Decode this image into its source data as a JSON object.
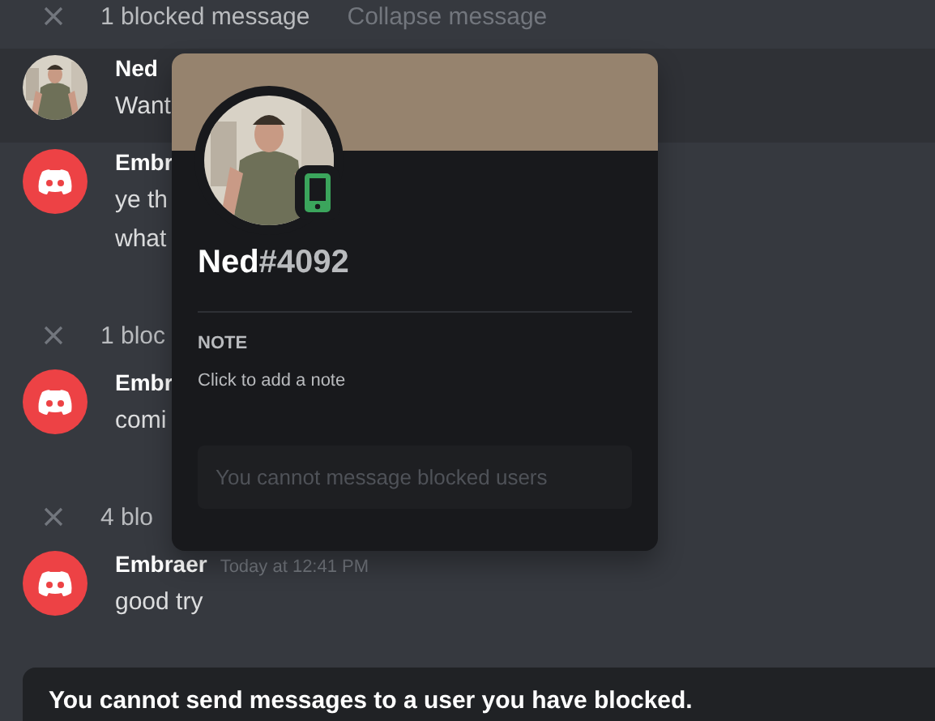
{
  "chat": [
    {
      "kind": "blocked",
      "label": "1 blocked message",
      "action": "Collapse message"
    },
    {
      "kind": "message",
      "avatar": {
        "kind": "picture"
      },
      "highlighted": true,
      "author": "Ned",
      "lines": [
        "Want"
      ]
    },
    {
      "kind": "message",
      "avatar": {
        "kind": "logo"
      },
      "author": "Embr",
      "lines": [
        "ye th",
        "what"
      ]
    },
    {
      "kind": "blocked",
      "label": "1 bloc"
    },
    {
      "kind": "message",
      "avatar": {
        "kind": "logo"
      },
      "author": "Embr",
      "lines": [
        "comi"
      ]
    },
    {
      "kind": "blocked",
      "label": "4 blo"
    },
    {
      "kind": "message",
      "avatar": {
        "kind": "logo"
      },
      "author": "Embraer",
      "time": "Today at 12:41 PM",
      "lines": [
        "good try"
      ]
    }
  ],
  "blocked_notice": "You cannot send messages to a user you have blocked.",
  "profile": {
    "username": "Ned",
    "discriminator": "#4092",
    "on_mobile": true,
    "note_heading": "NOTE",
    "note_placeholder": "Click to add a note",
    "message_placeholder": "You cannot message blocked users"
  }
}
